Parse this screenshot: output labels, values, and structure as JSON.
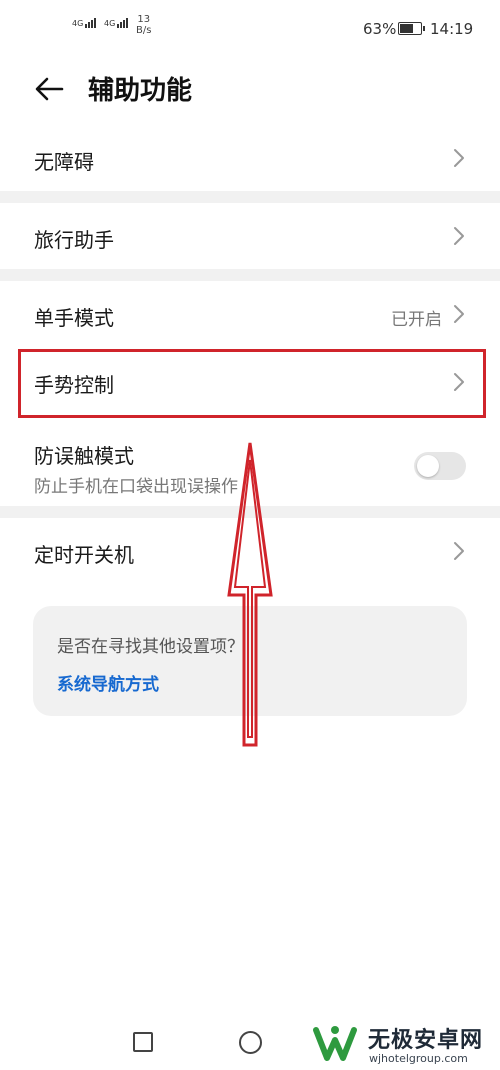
{
  "status_bar": {
    "signal_1_label": "4G",
    "signal_2_label": "4G",
    "net_speed_value": "13",
    "net_speed_unit": "B/s",
    "battery_percent": "63%",
    "battery_level": 0.63,
    "time": "14:19"
  },
  "header": {
    "back_icon": "arrow-left-icon",
    "title": "辅助功能"
  },
  "settings": {
    "accessibility": {
      "label": "无障碍"
    },
    "travel_assistant": {
      "label": "旅行助手"
    },
    "one_handed_mode": {
      "label": "单手模式",
      "value": "已开启"
    },
    "gesture_control": {
      "label": "手势控制"
    },
    "pocket_mode": {
      "label": "防误触模式",
      "description": "防止手机在口袋出现误操作",
      "enabled": false
    },
    "scheduled_power": {
      "label": "定时开关机"
    }
  },
  "suggestion_card": {
    "question": "是否在寻找其他设置项？",
    "link": "系统导航方式"
  },
  "watermark": {
    "name": "无极安卓网",
    "url": "wjhotelgroup.com"
  },
  "colors": {
    "highlight": "#d0242b",
    "link": "#1769d0",
    "separator": "#f1f1f1"
  }
}
